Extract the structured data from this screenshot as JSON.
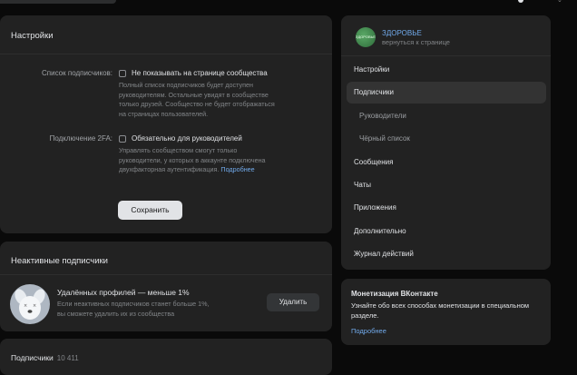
{
  "settings": {
    "title": "Настройки",
    "subscribers_list_label": "Список подписчиков:",
    "subscribers_list_option": "Не показывать на странице сообщества",
    "subscribers_list_hint": [
      "Полный список подписчиков будет доступен",
      "руководителям. Остальные увидят в сообществе",
      "только друзей. Сообщество не будет отображаться",
      "на страницах пользователей."
    ],
    "twofa_label": "Подключение 2FA:",
    "twofa_option": "Обязательно для руководителей",
    "twofa_hint": [
      "Управлять сообществом смогут только",
      "руководители, у которых в аккаунте подключена",
      "двухфакторная аутентификация."
    ],
    "twofa_link": "Подробнее",
    "save_label": "Сохранить"
  },
  "inactive": {
    "title": "Неактивные подписчики",
    "item_title": "Удалённых профилей — меньше 1%",
    "item_hint": [
      "Если неактивных подписчиков станет больше 1%,",
      "вы сможете удалить их из сообщества"
    ],
    "delete_label": "Удалить"
  },
  "subscribers": {
    "title": "Подписчики",
    "count": "10 411"
  },
  "community": {
    "avatar_text": "ЗДОРОВЬЕ",
    "name": "ЗДОРОВЬЕ",
    "back": "вернуться к странице"
  },
  "nav": {
    "items": [
      {
        "label": "Настройки"
      },
      {
        "label": "Подписчики"
      },
      {
        "label": "Руководители"
      },
      {
        "label": "Чёрный список"
      },
      {
        "label": "Сообщения"
      },
      {
        "label": "Чаты"
      },
      {
        "label": "Приложения"
      },
      {
        "label": "Дополнительно"
      },
      {
        "label": "Журнал действий"
      }
    ]
  },
  "monetization": {
    "title": "Монетизация ВКонтакте",
    "text": "Узнайте обо всех способах монетизации в специальном разделе.",
    "link": "Подробнее"
  }
}
